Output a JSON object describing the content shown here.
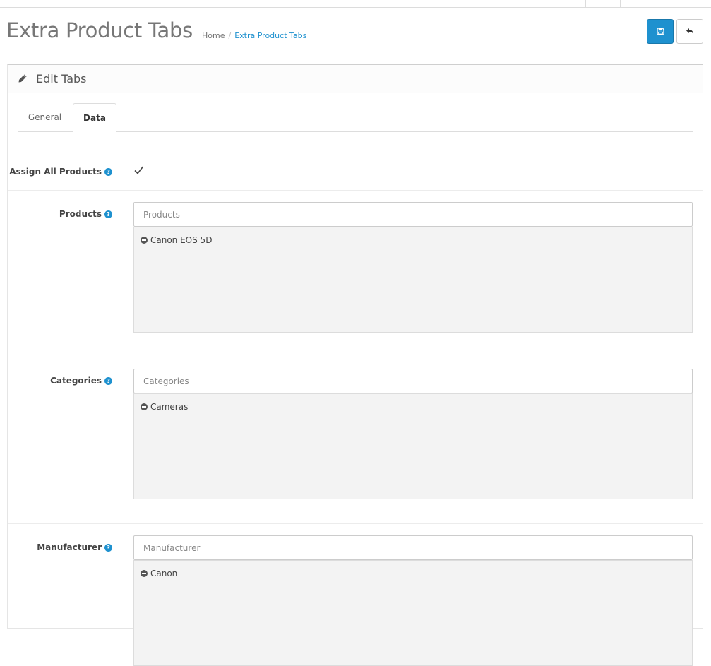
{
  "header": {
    "title": "Extra Product Tabs",
    "breadcrumb": {
      "home": "Home",
      "separator": "/",
      "current": "Extra Product Tabs"
    },
    "save_icon": "save-icon",
    "back_icon": "reply-icon"
  },
  "panel": {
    "heading": "Edit Tabs",
    "icon": "pencil-icon"
  },
  "tabs": [
    {
      "label": "General",
      "active": false
    },
    {
      "label": "Data",
      "active": true
    }
  ],
  "form": {
    "assign_all": {
      "label": "Assign All Products",
      "checked": true
    },
    "products": {
      "label": "Products",
      "placeholder": "Products",
      "value": "",
      "items": [
        "Canon EOS 5D"
      ]
    },
    "categories": {
      "label": "Categories",
      "placeholder": "Categories",
      "value": "",
      "items": [
        "Cameras"
      ]
    },
    "manufacturer": {
      "label": "Manufacturer",
      "placeholder": "Manufacturer",
      "value": "",
      "items": [
        "Canon"
      ]
    }
  },
  "colors": {
    "primary": "#1e91cf",
    "help": "#1e91cf",
    "well_bg": "#f3f3f3"
  }
}
